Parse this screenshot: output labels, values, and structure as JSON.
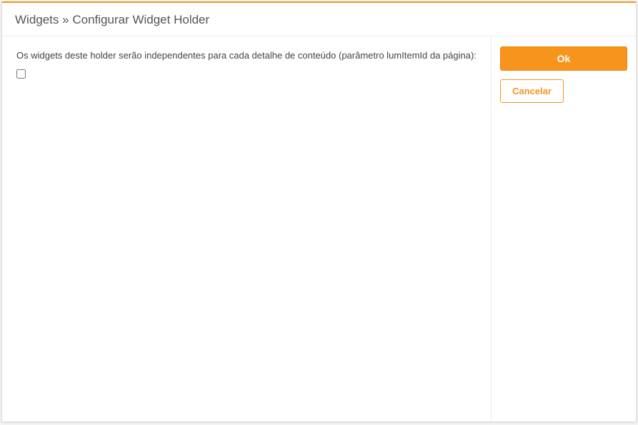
{
  "header": {
    "breadcrumb_root": "Widgets",
    "breadcrumb_separator": "»",
    "breadcrumb_current": "Configurar Widget Holder"
  },
  "main": {
    "independent_widgets_label": "Os widgets deste holder serão independentes para cada detalhe de conteúdo (parâmetro lumItemId da página):",
    "independent_widgets_checked": false
  },
  "actions": {
    "ok_label": "Ok",
    "cancel_label": "Cancelar"
  }
}
